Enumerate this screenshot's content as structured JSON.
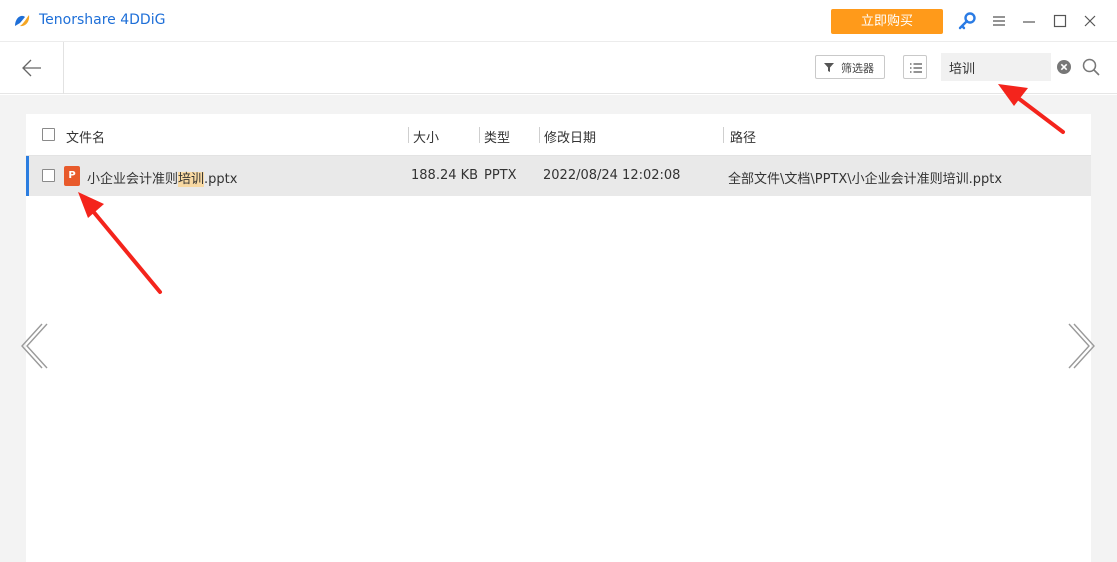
{
  "app": {
    "title": "Tenorshare 4DDiG",
    "buy_label": "立即购买"
  },
  "toolbar": {
    "filter_label": "筛选器",
    "search_value": "培训"
  },
  "table": {
    "headers": {
      "name": "文件名",
      "size": "大小",
      "type": "类型",
      "date": "修改日期",
      "path": "路径"
    },
    "rows": [
      {
        "name_before": "小企业会计准则",
        "name_match": "培训",
        "name_after": ".pptx",
        "icon_letter": "P",
        "size": "188.24 KB",
        "type": "PPTX",
        "date": "2022/08/24 12:02:08",
        "path": "全部文件\\文档\\PPTX\\小企业会计准则培训.pptx"
      }
    ]
  },
  "colors": {
    "brand_blue": "#1e6fd8",
    "buy_orange": "#ff9a1a",
    "row_selected": "#e9e9e9",
    "highlight": "#f8d9a3",
    "annotation_red": "#f4241c"
  }
}
